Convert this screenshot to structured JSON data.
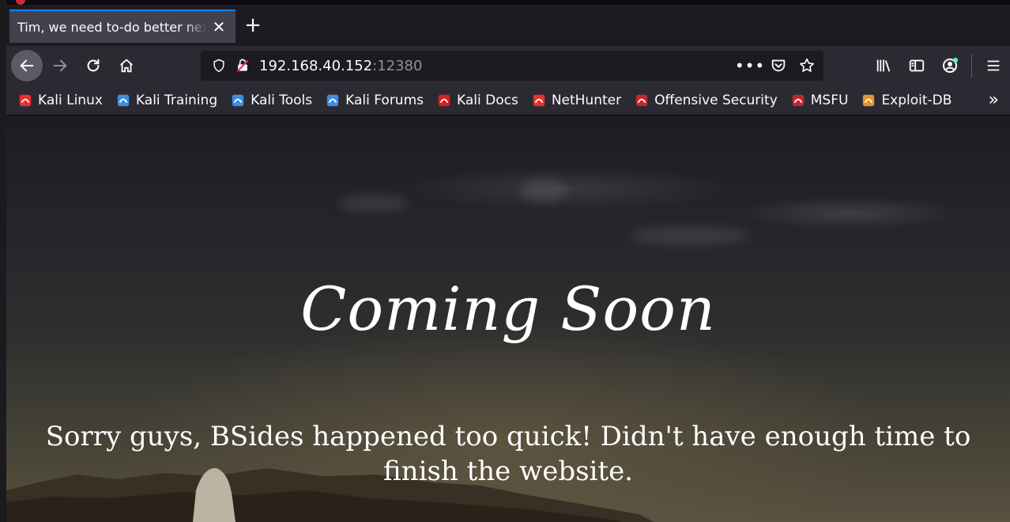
{
  "tab": {
    "title": "Tim, we need to-do better next year for Initech",
    "close_icon": "close-icon",
    "new_tab_icon": "plus-icon"
  },
  "nav": {
    "back_icon": "arrow-left-icon",
    "forward_icon": "arrow-right-icon",
    "reload_icon": "reload-icon",
    "home_icon": "home-icon"
  },
  "urlbar": {
    "host": "192.168.40.152",
    "port": ":12380",
    "shield_icon": "shield-icon",
    "insecure_icon": "insecure-lock-icon",
    "more_icon": "ellipsis-icon",
    "pocket_icon": "pocket-icon",
    "star_icon": "star-icon"
  },
  "toolbar": {
    "library_icon": "library-icon",
    "sidebar_icon": "sidebar-icon",
    "account_icon": "account-icon",
    "menu_icon": "hamburger-menu-icon"
  },
  "bookmarks": [
    {
      "label": "Kali Linux",
      "icon": "kali-icon",
      "color": "#e8322e"
    },
    {
      "label": "Kali Training",
      "icon": "kali-training-icon",
      "color": "#3c8ee0"
    },
    {
      "label": "Kali Tools",
      "icon": "kali-tools-icon",
      "color": "#3c8ee0"
    },
    {
      "label": "Kali Forums",
      "icon": "kali-forums-icon",
      "color": "#3c8ee0"
    },
    {
      "label": "Kali Docs",
      "icon": "kali-docs-icon",
      "color": "#d42020"
    },
    {
      "label": "NetHunter",
      "icon": "nethunter-icon",
      "color": "#e8322e"
    },
    {
      "label": "Offensive Security",
      "icon": "offsec-icon",
      "color": "#c2272d"
    },
    {
      "label": "MSFU",
      "icon": "msfu-icon",
      "color": "#c2272d"
    },
    {
      "label": "Exploit-DB",
      "icon": "exploitdb-icon",
      "color": "#e8922e"
    }
  ],
  "page": {
    "heading": "Coming Soon",
    "message": "Sorry guys, BSides happened too quick! Didn't have enough time to finish the website."
  }
}
